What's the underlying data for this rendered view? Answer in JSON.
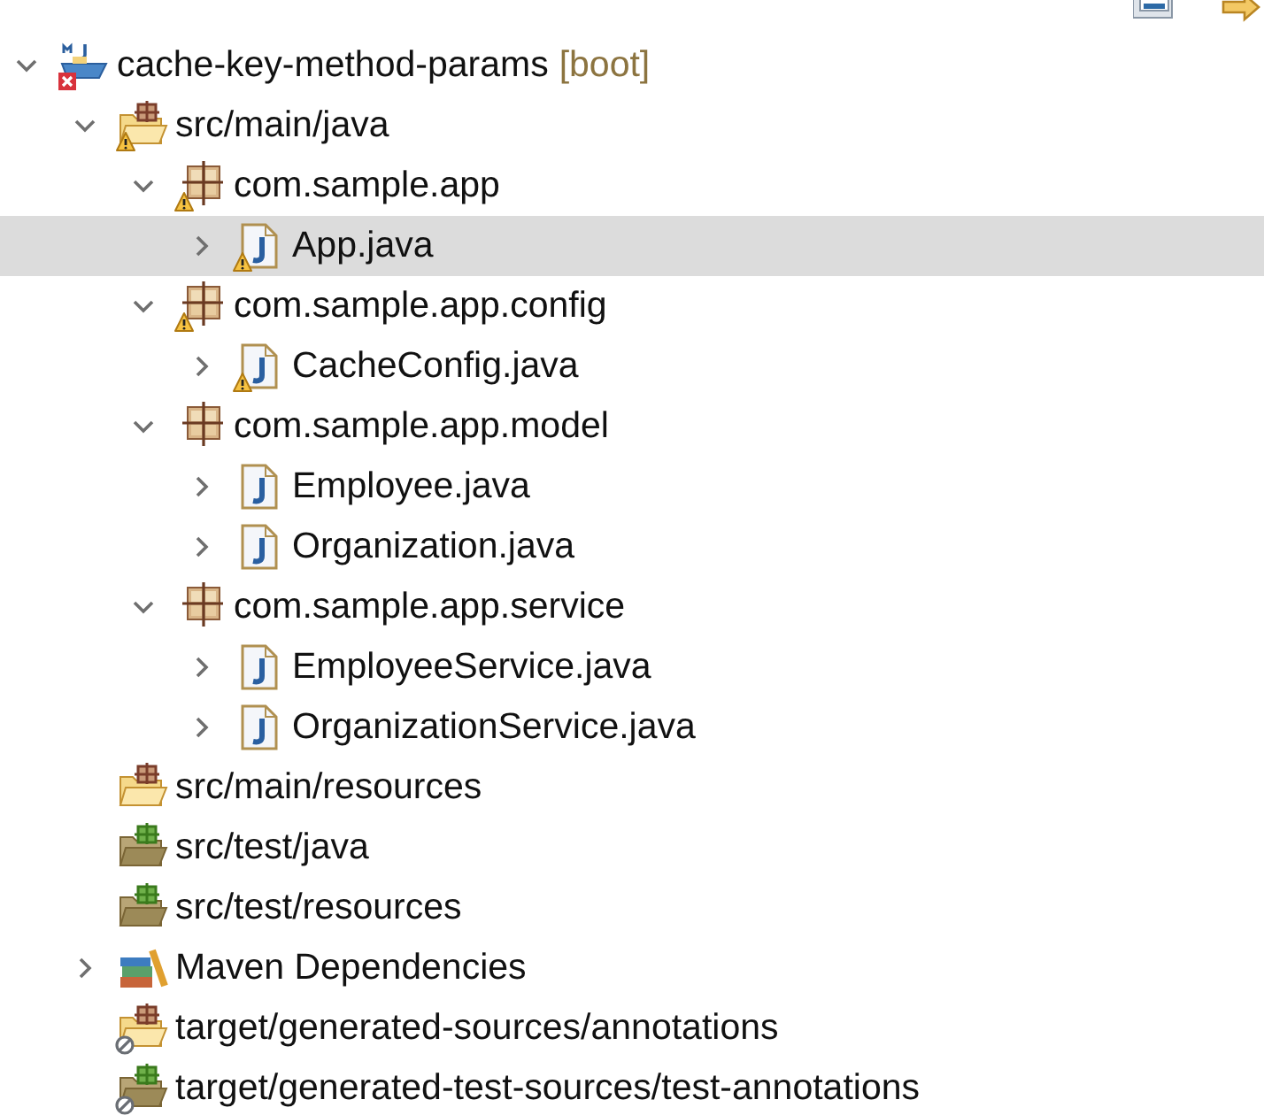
{
  "tree": [
    {
      "label": "cache-key-method-params",
      "suffix": "[boot]",
      "kind": "project",
      "error": true,
      "warning": false,
      "expanded": true,
      "selected": false,
      "children": [
        {
          "label": "src/main/java",
          "kind": "source-folder",
          "warning": true,
          "excluded": false,
          "expanded": true,
          "selected": false,
          "children": [
            {
              "label": "com.sample.app",
              "kind": "package",
              "warning": true,
              "expanded": true,
              "selected": false,
              "children": [
                {
                  "label": "App.java",
                  "kind": "java-file",
                  "warning": true,
                  "expanded": false,
                  "selected": true
                }
              ]
            },
            {
              "label": "com.sample.app.config",
              "kind": "package",
              "warning": true,
              "expanded": true,
              "selected": false,
              "children": [
                {
                  "label": "CacheConfig.java",
                  "kind": "java-file",
                  "warning": true,
                  "expanded": false,
                  "selected": false
                }
              ]
            },
            {
              "label": "com.sample.app.model",
              "kind": "package",
              "warning": false,
              "expanded": true,
              "selected": false,
              "children": [
                {
                  "label": "Employee.java",
                  "kind": "java-file",
                  "warning": false,
                  "expanded": false,
                  "selected": false
                },
                {
                  "label": "Organization.java",
                  "kind": "java-file",
                  "warning": false,
                  "expanded": false,
                  "selected": false
                }
              ]
            },
            {
              "label": "com.sample.app.service",
              "kind": "package",
              "warning": false,
              "expanded": true,
              "selected": false,
              "children": [
                {
                  "label": "EmployeeService.java",
                  "kind": "java-file",
                  "warning": false,
                  "expanded": false,
                  "selected": false
                },
                {
                  "label": "OrganizationService.java",
                  "kind": "java-file",
                  "warning": false,
                  "expanded": false,
                  "selected": false
                }
              ]
            }
          ]
        },
        {
          "label": "src/main/resources",
          "kind": "source-folder",
          "warning": false,
          "excluded": false,
          "selected": false
        },
        {
          "label": "src/test/java",
          "kind": "test-folder",
          "warning": false,
          "excluded": false,
          "selected": false
        },
        {
          "label": "src/test/resources",
          "kind": "test-folder",
          "warning": false,
          "excluded": false,
          "selected": false
        },
        {
          "label": "Maven Dependencies",
          "kind": "library",
          "warning": false,
          "excluded": false,
          "expanded": false,
          "selected": false
        },
        {
          "label": "target/generated-sources/annotations",
          "kind": "source-folder",
          "warning": false,
          "excluded": true,
          "selected": false
        },
        {
          "label": "target/generated-test-sources/test-annotations",
          "kind": "test-folder",
          "warning": false,
          "excluded": true,
          "selected": false
        }
      ]
    }
  ]
}
